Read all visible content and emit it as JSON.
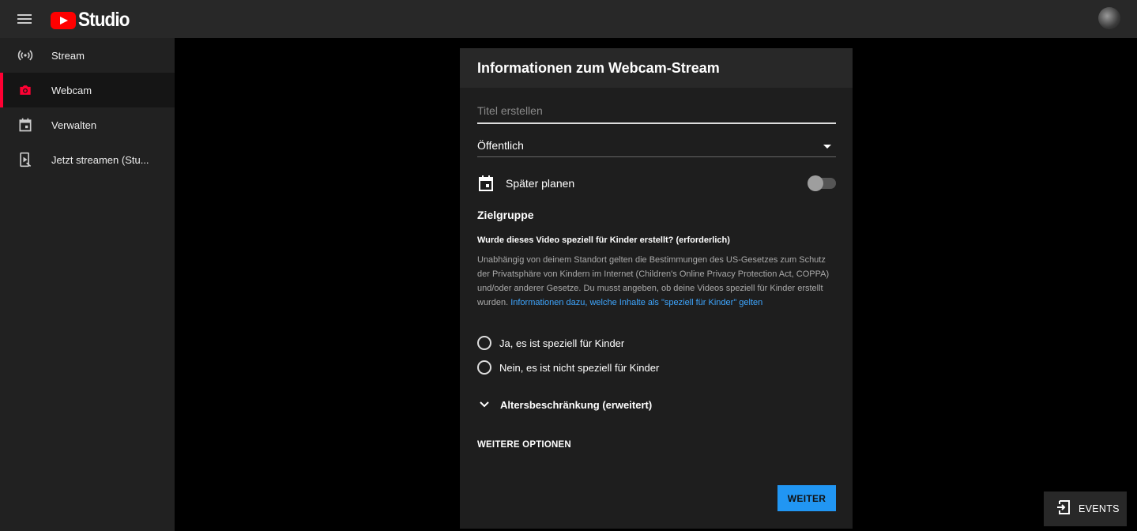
{
  "app": {
    "logo_text": "Studio"
  },
  "sidebar": {
    "items": [
      {
        "label": "Stream",
        "icon": "broadcast-icon"
      },
      {
        "label": "Webcam",
        "icon": "camera-icon",
        "active": true
      },
      {
        "label": "Verwalten",
        "icon": "calendar-icon"
      },
      {
        "label": "Jetzt streamen (Stu...",
        "icon": "stream-now-icon"
      }
    ]
  },
  "panel": {
    "title": "Informationen zum Webcam-Stream",
    "title_input": {
      "value": "",
      "placeholder": "Titel erstellen"
    },
    "visibility": {
      "value": "Öffentlich"
    },
    "schedule": {
      "label": "Später planen",
      "enabled": false
    },
    "audience": {
      "section_title": "Zielgruppe",
      "question": "Wurde dieses Video speziell für Kinder erstellt? (erforderlich)",
      "info_text": "Unabhängig von deinem Standort gelten die Bestimmungen des US-Gesetzes zum Schutz der Privatsphäre von Kindern im Internet (Children's Online Privacy Protection Act, COPPA) und/oder anderer Gesetze. Du musst angeben, ob deine Videos speziell für Kinder erstellt wurden. ",
      "info_link": "Informationen dazu, welche Inhalte als \"speziell für Kinder\" gelten",
      "option_yes": "Ja, es ist speziell für Kinder",
      "option_no": "Nein, es ist nicht speziell für Kinder"
    },
    "age_restriction": "Altersbeschränkung (erweitert)",
    "more_options": "WEITERE OPTIONEN",
    "next_button": "WEITER"
  },
  "events_button": "EVENTS",
  "colors": {
    "accent_red": "#ff0033",
    "primary_blue": "#2196f3",
    "link_blue": "#3ea6ff"
  }
}
